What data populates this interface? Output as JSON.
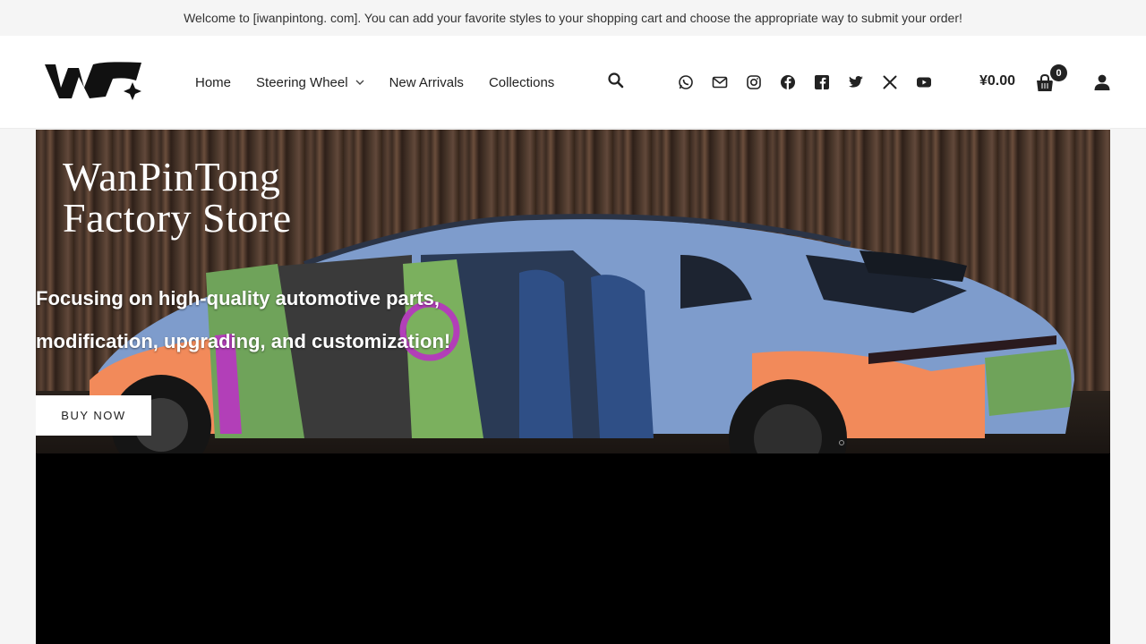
{
  "topbar": {
    "message": "Welcome to [iwanpintong. com]. You can add your favorite styles to your shopping cart and choose the appropriate way to submit your order!"
  },
  "header": {
    "nav": [
      {
        "label": "Home"
      },
      {
        "label": "Steering Wheel",
        "has_dropdown": true
      },
      {
        "label": "New Arrivals"
      },
      {
        "label": "Collections"
      }
    ],
    "socials": [
      "whatsapp-icon",
      "email-icon",
      "instagram-icon",
      "facebook-icon",
      "facebook-square-icon",
      "twitter-icon",
      "x-icon",
      "youtube-icon"
    ],
    "cart": {
      "total": "¥0.00",
      "count": "0"
    }
  },
  "hero": {
    "title_line1": "WanPinTong",
    "title_line2": "Factory Store",
    "subtitle_line1": "Focusing on high-quality automotive parts,",
    "subtitle_line2": "modification, upgrading, and customization!",
    "cta_label": "BUY NOW"
  },
  "colors": {
    "brand_dark": "#111111",
    "topbar_bg": "#f5f5f5",
    "car_blue": "#7e9ccc",
    "car_orange": "#f28a5a",
    "car_green": "#6fa35a",
    "car_purple": "#b23fb8"
  }
}
